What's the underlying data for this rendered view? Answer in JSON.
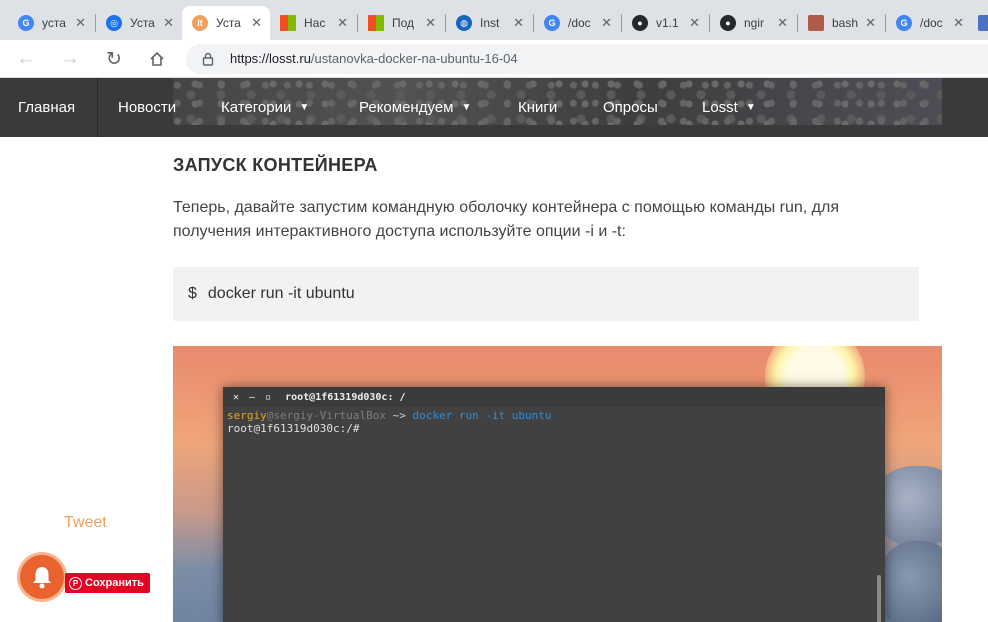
{
  "browser": {
    "tabs": [
      {
        "title": "уста",
        "icon": "google-icon",
        "color": "#4285f4"
      },
      {
        "title": "Уста",
        "icon": "chromium-icon",
        "color": "#1a73e8"
      },
      {
        "title": "Уста",
        "icon": "losst-icon",
        "color": "#f0a05c",
        "active": true
      },
      {
        "title": "Нас",
        "icon": "microsoft-icon",
        "color": "#7fba00"
      },
      {
        "title": "Под",
        "icon": "microsoft-icon",
        "color": "#7fba00"
      },
      {
        "title": "Inst",
        "icon": "globe-icon",
        "color": "#1565c0"
      },
      {
        "title": "/doc",
        "icon": "google-icon",
        "color": "#4285f4"
      },
      {
        "title": "v1.1",
        "icon": "github-icon",
        "color": "#24292e"
      },
      {
        "title": "ngir",
        "icon": "github-icon",
        "color": "#24292e"
      },
      {
        "title": "bash",
        "icon": "page-icon",
        "color": "#b05a4a"
      },
      {
        "title": "/doc",
        "icon": "google-icon",
        "color": "#4285f4"
      }
    ],
    "url_host": "https://losst.ru",
    "url_path": "/ustanovka-docker-na-ubuntu-16-04"
  },
  "site_nav": {
    "items": [
      {
        "label": "Главная",
        "dropdown": false
      },
      {
        "label": "Новости",
        "dropdown": false
      },
      {
        "label": "Категории",
        "dropdown": true
      },
      {
        "label": "Рекомендуем",
        "dropdown": true
      },
      {
        "label": "Книги",
        "dropdown": false
      },
      {
        "label": "Опросы",
        "dropdown": false
      },
      {
        "label": "Losst",
        "dropdown": true
      }
    ]
  },
  "article": {
    "heading": "ЗАПУСК КОНТЕЙНЕРА",
    "paragraph": "Теперь, давайте запустим командную оболочку контейнера с помощью команды run, для получения интерактивного доступа используйте опции -i и -t:",
    "code_prompt": "$",
    "code": "docker run -it ubuntu",
    "terminal": {
      "title": "root@1f61319d030c: /",
      "user": "sergiy",
      "host": "@sergiy-VirtualBox",
      "arrow": "~>",
      "command": "docker run -it ubuntu",
      "line2": "root@1f61319d030c:/#"
    }
  },
  "widgets": {
    "tweet": "Tweet",
    "pin_save": "Сохранить"
  }
}
